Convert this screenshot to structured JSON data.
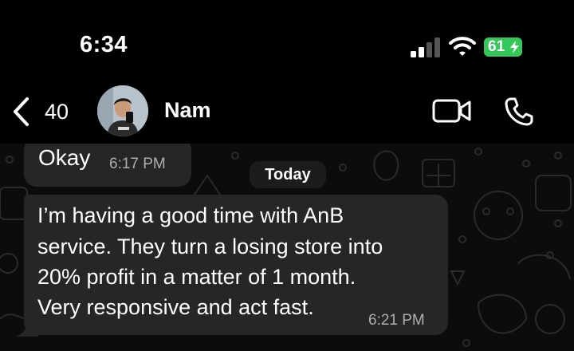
{
  "status_bar": {
    "time": "6:34",
    "battery": "61",
    "battery_color": "#34c759",
    "icons": [
      "signal-icon",
      "wifi-icon",
      "charging-bolt-icon"
    ]
  },
  "header": {
    "back_count": "40",
    "contact_name": "Nam",
    "icons": [
      "chevron-left-icon",
      "video-call-icon",
      "phone-call-icon"
    ]
  },
  "chat": {
    "date_separator": "Today",
    "messages": [
      {
        "text": "Okay",
        "time": "6:17 PM"
      },
      {
        "lines": [
          "I’m having a good time with AnB",
          "service. They turn a losing store into",
          "20% profit in a matter of 1 month.",
          "Very responsive and act fast."
        ],
        "time": "6:21 PM"
      }
    ]
  },
  "colors": {
    "background": "#000000",
    "bubble": "#262626",
    "timestamp": "#aeaeb2"
  }
}
